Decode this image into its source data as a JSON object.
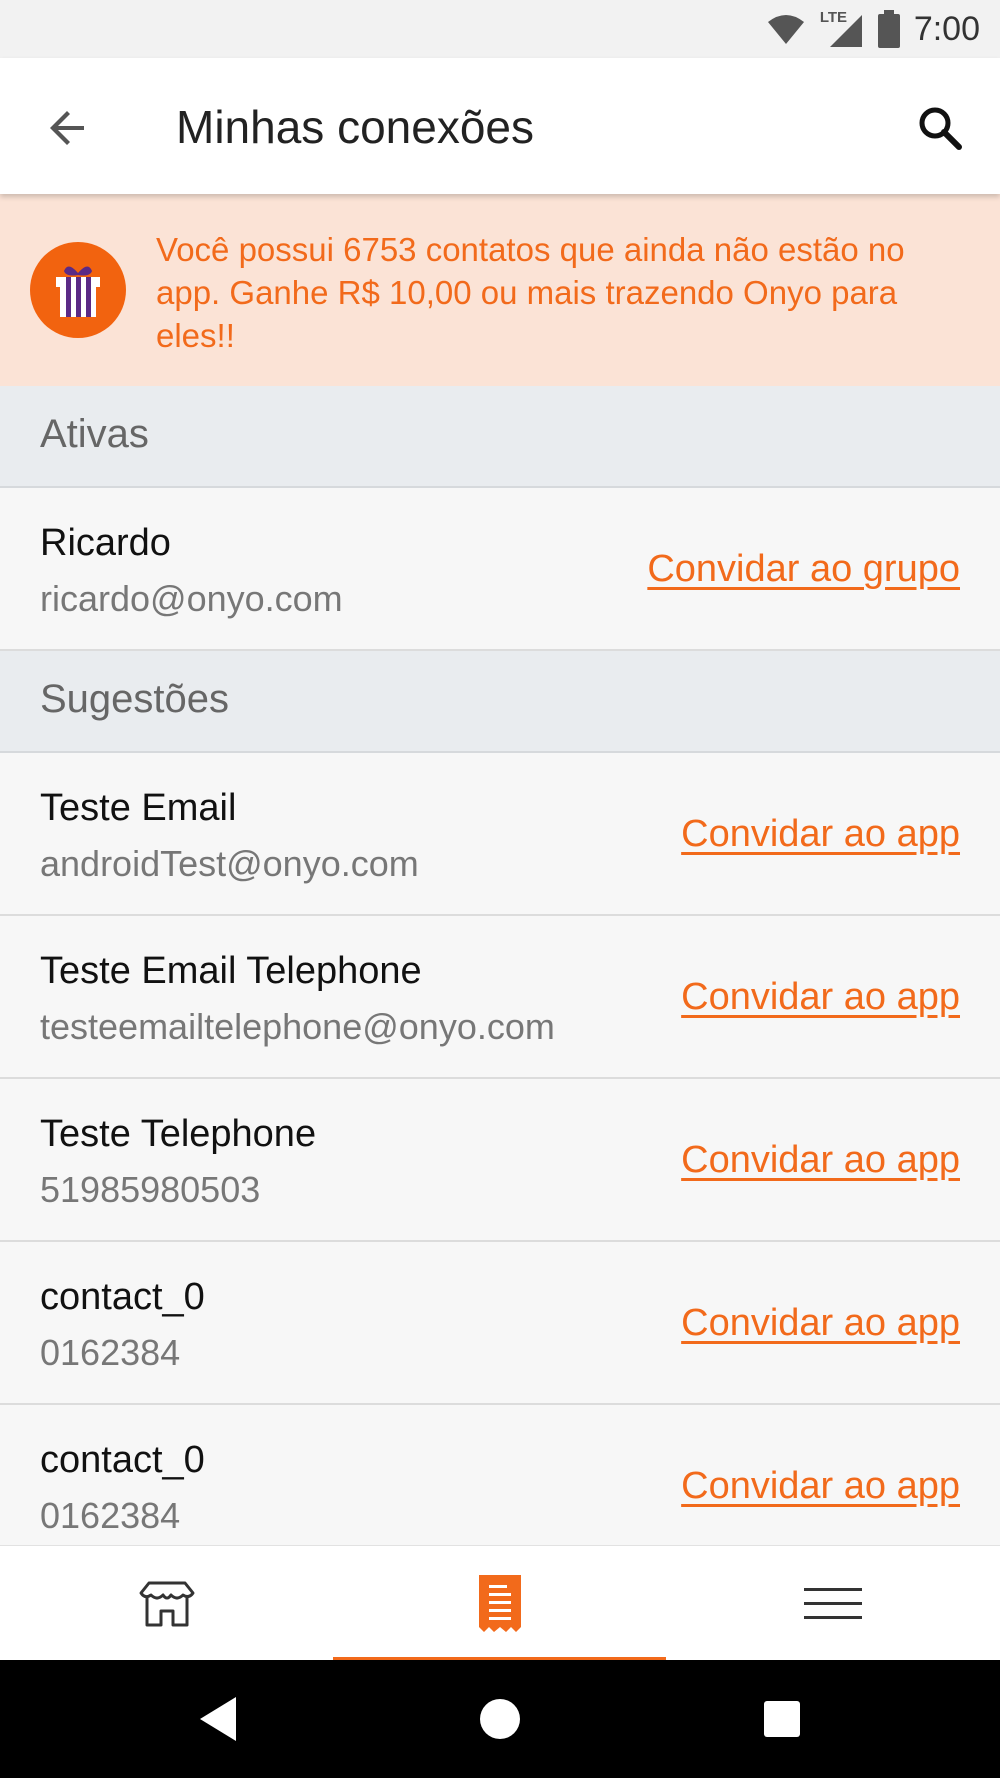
{
  "status_bar": {
    "network": "LTE",
    "time": "7:00"
  },
  "app_bar": {
    "title": "Minhas conexões",
    "back_icon": "arrow-left-icon",
    "search_icon": "search-icon"
  },
  "banner": {
    "icon": "gift-icon",
    "text": "Você possui 6753 contatos que ainda não estão no app. Ganhe R$ 10,00 ou mais trazendo Onyo para eles!!"
  },
  "sections": {
    "active": {
      "title": "Ativas",
      "items": [
        {
          "name": "Ricardo",
          "detail": "ricardo@onyo.com",
          "action": "Convidar ao grupo"
        }
      ]
    },
    "suggestions": {
      "title": "Sugestões",
      "items": [
        {
          "name": "Teste Email",
          "detail": "androidTest@onyo.com",
          "action": "Convidar ao app"
        },
        {
          "name": "Teste Email Telephone",
          "detail": "testeemailtelephone@onyo.com",
          "action": "Convidar ao app"
        },
        {
          "name": "Teste Telephone",
          "detail": "51985980503",
          "action": "Convidar ao app"
        },
        {
          "name": "contact_0",
          "detail": "0162384",
          "action": "Convidar ao app"
        },
        {
          "name": "contact_0",
          "detail": "0162384",
          "action": "Convidar ao app"
        }
      ]
    }
  },
  "bottom_nav": {
    "items": [
      {
        "icon": "store-icon",
        "active": false
      },
      {
        "icon": "receipt-icon",
        "active": true
      },
      {
        "icon": "menu-icon",
        "active": false
      }
    ]
  },
  "colors": {
    "accent": "#f26a1b",
    "banner_bg": "#fbe3d6",
    "section_bg": "#e9ecef"
  }
}
